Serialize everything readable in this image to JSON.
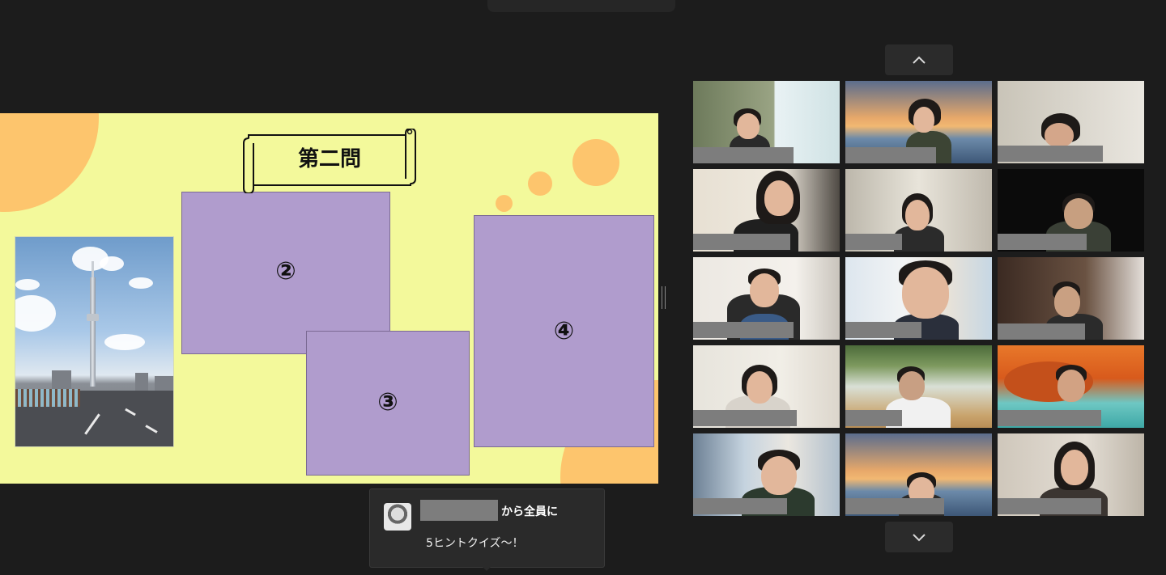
{
  "slide": {
    "title": "第二問",
    "box_labels": [
      "②",
      "③",
      "④"
    ],
    "background_color": "#f3f99b",
    "box_color": "#b09ccd",
    "accent_circle_color": "#fdc56d"
  },
  "gallery": {
    "scroll_up_icon": "chevron-up-icon",
    "scroll_down_icon": "chevron-down-icon",
    "participant_count": 15
  },
  "chat_popup": {
    "recipient_text": "から全員に",
    "message": "5ヒントクイズ～！"
  }
}
